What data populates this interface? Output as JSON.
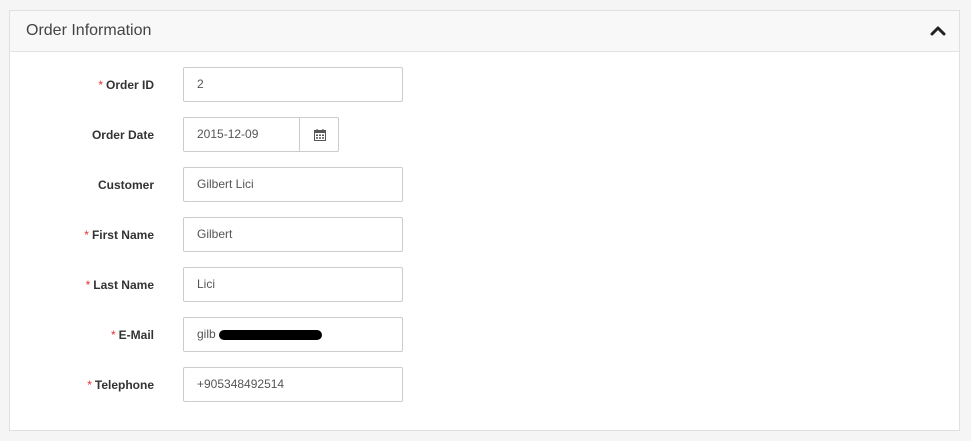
{
  "panel": {
    "title": "Order Information"
  },
  "fields": {
    "order_id": {
      "label": "Order ID",
      "required_mark": "*",
      "value": "2"
    },
    "order_date": {
      "label": "Order Date",
      "value": "2015-12-09"
    },
    "customer": {
      "label": "Customer",
      "value": "Gilbert Lici"
    },
    "first_name": {
      "label": "First Name",
      "required_mark": "*",
      "value": "Gilbert"
    },
    "last_name": {
      "label": "Last Name",
      "required_mark": "*",
      "value": "Lici"
    },
    "email": {
      "label": "E-Mail",
      "required_mark": "*",
      "value": "gilb"
    },
    "telephone": {
      "label": "Telephone",
      "required_mark": "*",
      "value": "+905348492514"
    }
  },
  "icons": {
    "collapse": "chevron-up-icon",
    "calendar": "calendar-icon"
  },
  "colors": {
    "required": "#e23030",
    "border": "#cccccc",
    "heading_bg": "#f8f8f8"
  }
}
